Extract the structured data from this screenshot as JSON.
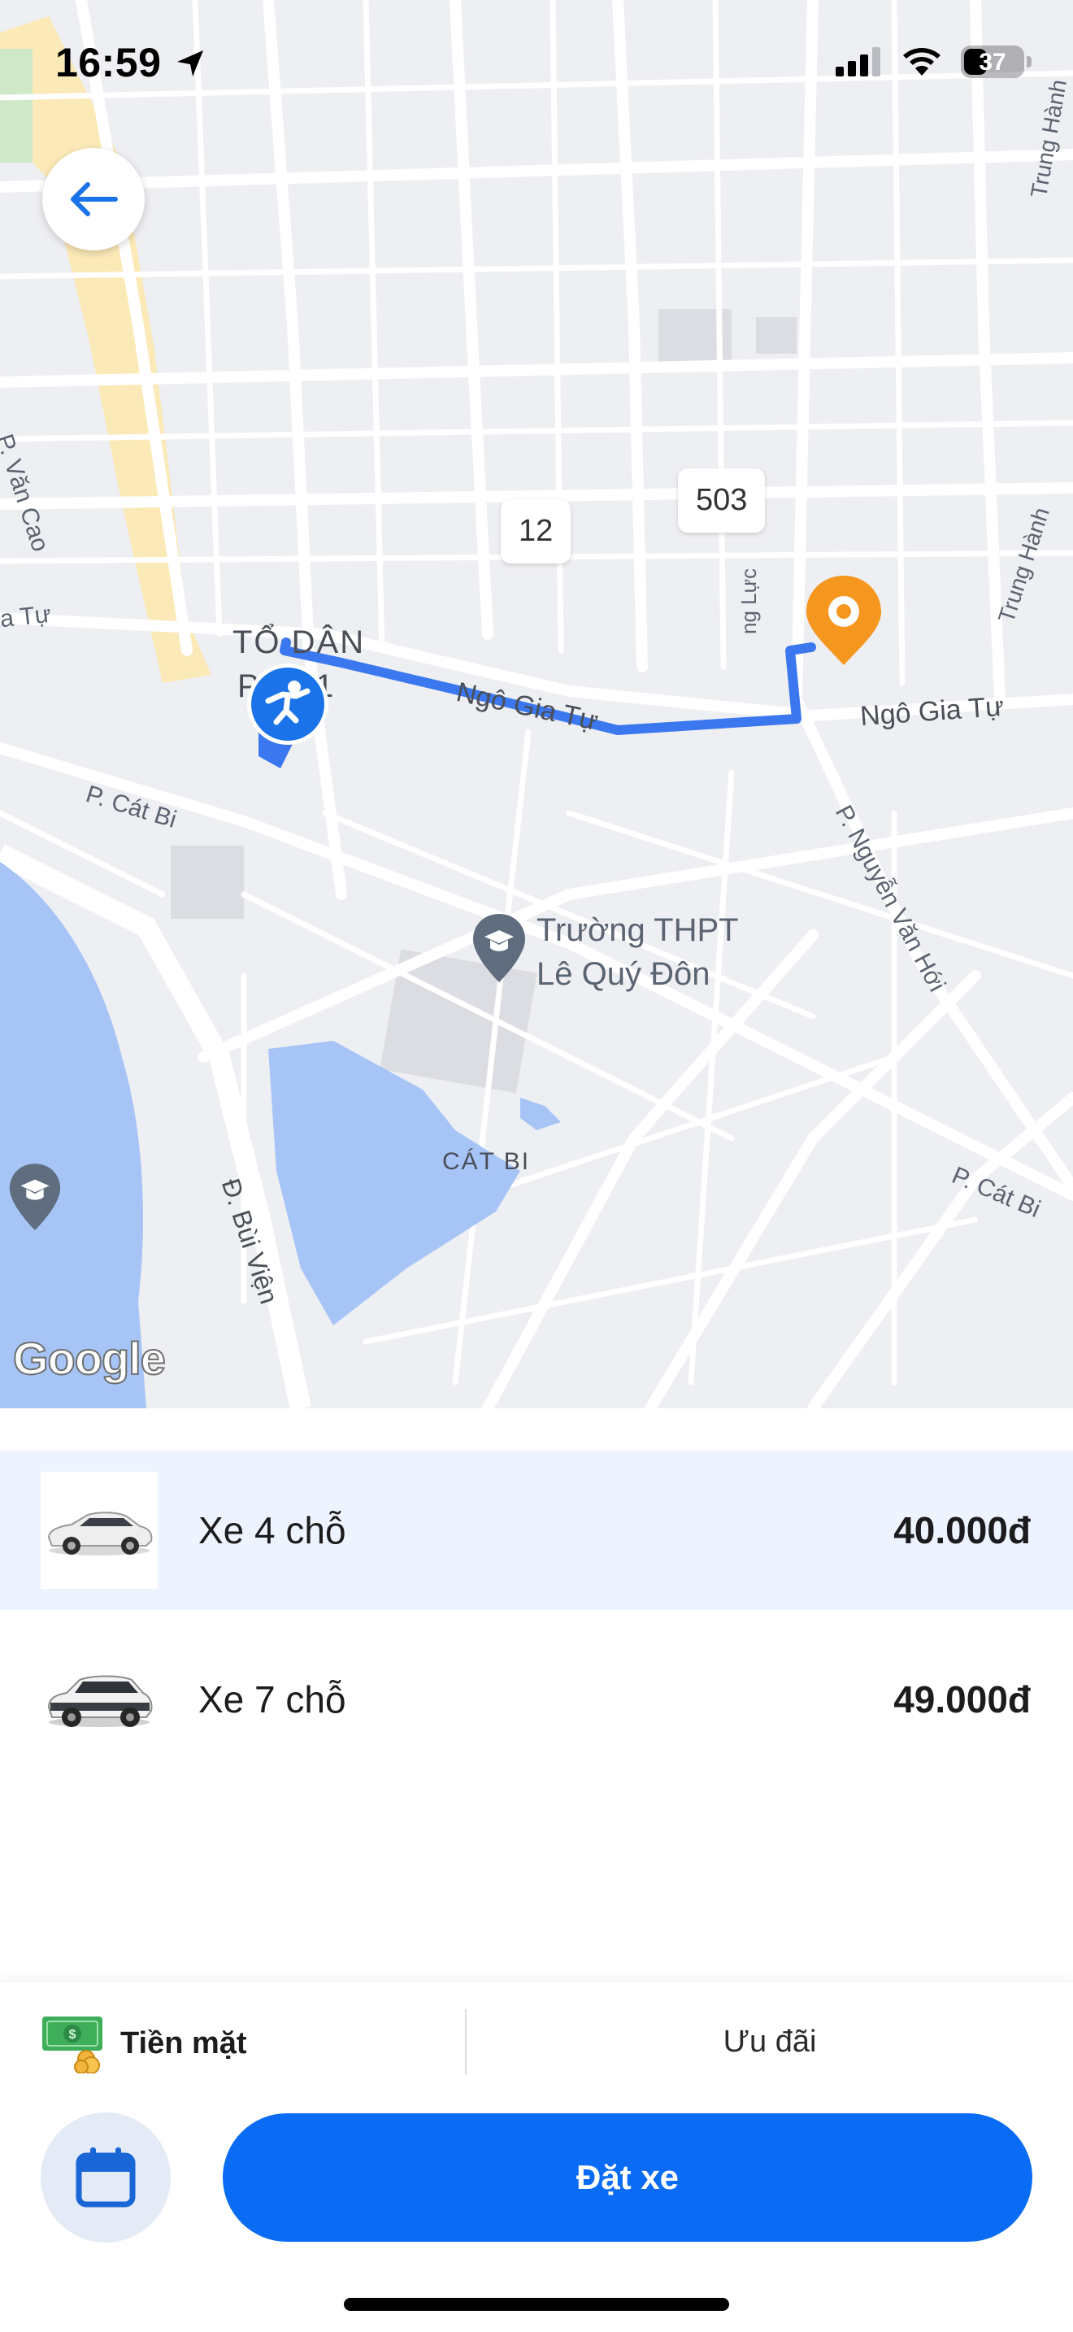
{
  "status_bar": {
    "time": "16:59",
    "battery_level": "37",
    "icons": [
      "location-arrow-icon",
      "cellular-signal-icon",
      "wifi-icon",
      "battery-icon"
    ]
  },
  "map": {
    "street_labels": {
      "van_cao": "P. Văn Cao",
      "gia_tu_left": "a Tự",
      "ngo_gia_tu_mid": "Ngô Gia Tự",
      "ngo_gia_tu_right": "Ngô Gia Tự",
      "cat_bi_left": "P. Cát Bi",
      "cat_bi_right": "P. Cát Bi",
      "nguyen_van_hoi": "P. Nguyễn Văn Hới",
      "bui_vien": "Đ. Bùi Viện",
      "trung_hanh_top": "Trung Hành",
      "trung_hanh_mid": "Trung Hành",
      "ung_luc": "ng Lực"
    },
    "area_labels": {
      "to_dan_line1": "TỔ DÂN",
      "to_dan_line2": "P   E1",
      "cat_bi_lake": "CÁT BI"
    },
    "school_label_line1": "Trường THPT",
    "school_label_line2": "Lê Quý Đôn",
    "road_badges": [
      "12",
      "503"
    ],
    "attribution": "Google",
    "colors": {
      "route": "#3b78f0",
      "water": "#a7c4f7",
      "destination": "#f5961e",
      "pickup": "#1a73e8"
    }
  },
  "vehicles": [
    {
      "name": "Xe 4 chỗ",
      "price": "40.000đ",
      "selected": true
    },
    {
      "name": "Xe 7 chỗ",
      "price": "49.000đ",
      "selected": false
    }
  ],
  "payment": {
    "method_label": "Tiền mặt",
    "promo_label": "Ưu đãi"
  },
  "actions": {
    "book_label": "Đặt xe"
  },
  "colors": {
    "accent": "#0a6cf5",
    "selected_row": "#eef4ff",
    "schedule_bg": "#e4ebf6"
  }
}
